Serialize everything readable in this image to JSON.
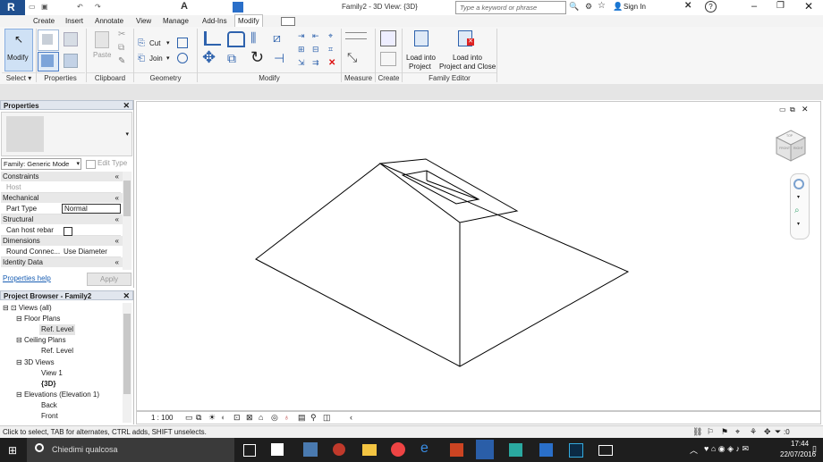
{
  "window": {
    "title": "Family2 - 3D View: {3D}"
  },
  "search": {
    "placeholder": "Type a keyword or phrase"
  },
  "account": {
    "sign_in": "Sign In"
  },
  "ribbon_tabs": [
    "Create",
    "Insert",
    "Annotate",
    "View",
    "Manage",
    "Add-Ins",
    "Modify"
  ],
  "ribbon": {
    "modify_label": "Modify",
    "paste_label": "Paste",
    "cut_label": "Cut",
    "join_label": "Join",
    "load_into_project": [
      "Load into",
      "Project"
    ],
    "load_into_project_close": [
      "Load into",
      "Project and Close"
    ],
    "panels": {
      "select": "Select",
      "properties": "Properties",
      "clipboard": "Clipboard",
      "geometry": "Geometry",
      "modify": "Modify",
      "measure": "Measure",
      "create": "Create",
      "family_editor": "Family Editor"
    }
  },
  "properties": {
    "title": "Properties",
    "family_type": "Family: Generic Mode",
    "edit_type": "Edit Type",
    "categories": {
      "constraints": "Constraints",
      "mechanical": "Mechanical",
      "structural": "Structural",
      "dimensions": "Dimensions",
      "identity": "Identity Data"
    },
    "rows": {
      "host": "Host",
      "part_type_label": "Part Type",
      "part_type_value": "Normal",
      "can_host_rebar": "Can host rebar",
      "round_connector_label": "Round Connec...",
      "round_connector_value": "Use Diameter"
    },
    "help_link": "Properties help",
    "apply": "Apply"
  },
  "project_browser": {
    "title": "Project Browser - Family2",
    "items": [
      "Views (all)",
      "Floor Plans",
      "Ref. Level",
      "Ceiling Plans",
      "Ref. Level",
      "3D Views",
      "View 1",
      "{3D}",
      "Elevations (Elevation 1)",
      "Back",
      "Front"
    ]
  },
  "view_controls": {
    "scale": "1 : 100"
  },
  "viewcube": {
    "faces": [
      "TOP",
      "FRONT",
      "RIGHT"
    ]
  },
  "status": {
    "text": "Click to select, TAB for alternates, CTRL adds, SHIFT unselects.",
    "filter_count": ":0"
  },
  "taskbar": {
    "search_placeholder": "Chiedimi qualcosa",
    "time": "17:44",
    "date": "22/07/2016"
  }
}
